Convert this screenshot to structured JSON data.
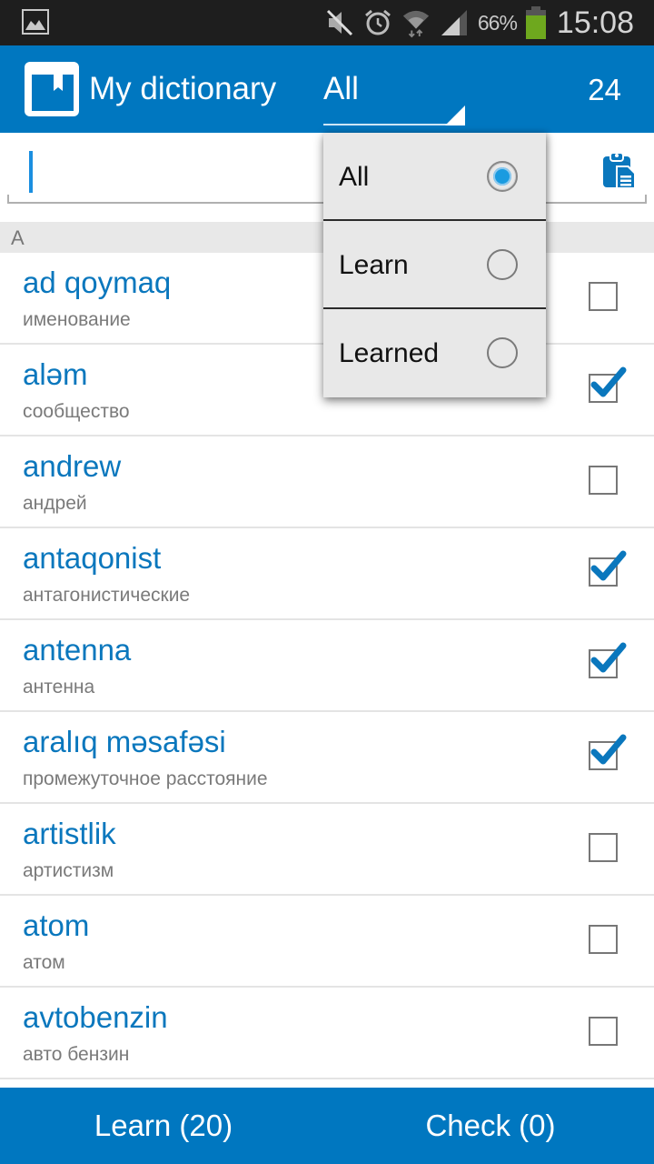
{
  "status_bar": {
    "icons": [
      "gallery-notification-icon",
      "mute-icon",
      "alarm-icon",
      "wifi-icon",
      "signal-icon",
      "battery-icon"
    ],
    "battery_percent": "66%",
    "time": "15:08",
    "battery_color": "#6ea81e"
  },
  "header": {
    "title": "My dictionary",
    "filter_selected": "All",
    "word_count": "24",
    "accent_color": "#0077c0"
  },
  "search": {
    "value": "",
    "placeholder": ""
  },
  "section_letter": "A",
  "dropdown": {
    "options": [
      {
        "label": "All",
        "selected": true
      },
      {
        "label": "Learn",
        "selected": false
      },
      {
        "label": "Learned",
        "selected": false
      }
    ]
  },
  "words": [
    {
      "word": "ad qoymaq",
      "translation": "именование",
      "learned": false
    },
    {
      "word": "aləm",
      "translation": "сообщество",
      "learned": true
    },
    {
      "word": "andrew",
      "translation": "андрей",
      "learned": false
    },
    {
      "word": "antaqonist",
      "translation": "антагонистические",
      "learned": true
    },
    {
      "word": "antenna",
      "translation": "антенна",
      "learned": true
    },
    {
      "word": "aralıq məsafəsi",
      "translation": "промежуточное расстояние",
      "learned": true
    },
    {
      "word": "artistlik",
      "translation": "артистизм",
      "learned": false
    },
    {
      "word": "atom",
      "translation": "атом",
      "learned": false
    },
    {
      "word": "avtobenzin",
      "translation": "авто бензин",
      "learned": false
    }
  ],
  "bottom_bar": {
    "learn_label": "Learn (20)",
    "check_label": "Check (0)"
  }
}
